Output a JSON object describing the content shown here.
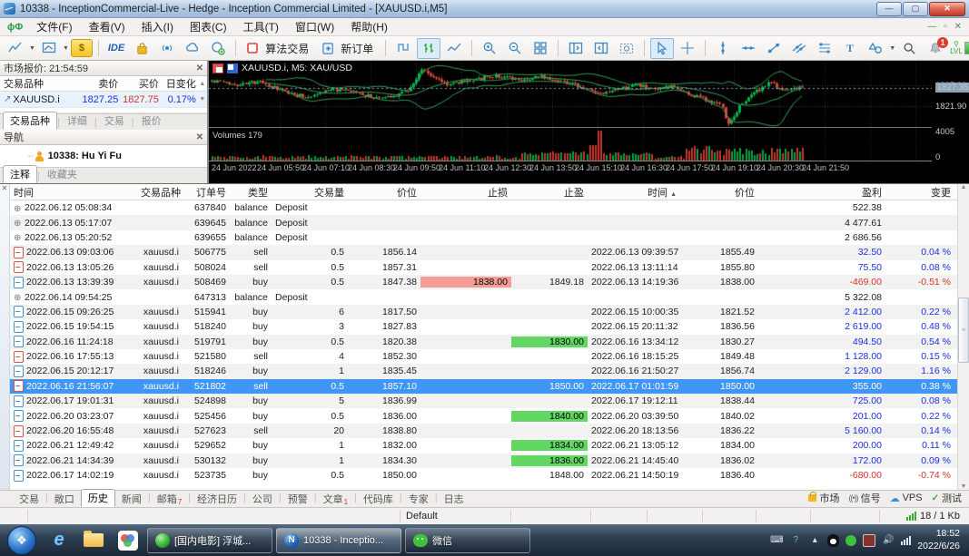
{
  "window": {
    "title": "10338 - InceptionCommercial-Live - Hedge - Inception Commercial Limited - [XAUUSD.i,M5]",
    "controls": {
      "minimize": "—",
      "maximize": "▢",
      "close": "✕"
    }
  },
  "menu": {
    "items": [
      "文件(F)",
      "查看(V)",
      "插入(I)",
      "图表(C)",
      "工具(T)",
      "窗口(W)",
      "帮助(H)"
    ]
  },
  "toolbar": {
    "ide_label": "IDE",
    "algo_label": "算法交易",
    "new_order_label": "新订单",
    "notification_count": "1",
    "lvl_label": "LVL"
  },
  "market_watch": {
    "title": "市场报价: 21:54:59",
    "columns": [
      "交易品种",
      "卖价",
      "买价",
      "日变化"
    ],
    "rows": [
      {
        "symbol": "XAUUSD.i",
        "bid": "1827.25",
        "ask": "1827.75",
        "change": "0.17%"
      }
    ],
    "tabs": [
      "交易品种",
      "详细",
      "交易",
      "报价"
    ],
    "active_tab": "交易品种"
  },
  "navigator": {
    "title": "导航",
    "account": "10338:   Hu Yi Fu",
    "tabs": [
      "注释",
      "收藏夹"
    ],
    "active_tab": "注释"
  },
  "chart_data": {
    "type": "candlestick",
    "title": "XAUUSD.i, M5:  XAU/USD",
    "symbol": "XAUUSD.i",
    "timeframe": "M5",
    "indicator": "Bollinger Bands",
    "current_price": "1827.35",
    "grid_prices": [
      1827.9,
      1821.9
    ],
    "grid_price_labels": [
      "1827.90",
      "1821.90"
    ],
    "price_range": [
      1815.8,
      1835.2
    ],
    "volume_label": "Volumes 179",
    "volume_axis_labels": [
      "4005",
      "0"
    ],
    "volume_max": 4005,
    "time_labels": [
      "24 Jun 2022",
      "24 Jun 05:50",
      "24 Jun 07:10",
      "24 Jun 08:30",
      "24 Jun 09:50",
      "24 Jun 11:10",
      "24 Jun 12:30",
      "24 Jun 13:50",
      "24 Jun 15:10",
      "24 Jun 16:30",
      "24 Jun 17:50",
      "24 Jun 19:10",
      "24 Jun 20:30",
      "24 Jun 21:50"
    ],
    "price_path": [
      [
        0,
        1829.3
      ],
      [
        0.04,
        1828.2
      ],
      [
        0.08,
        1829.0
      ],
      [
        0.12,
        1826.3
      ],
      [
        0.16,
        1824.6
      ],
      [
        0.2,
        1826.8
      ],
      [
        0.24,
        1826.0
      ],
      [
        0.28,
        1824.2
      ],
      [
        0.31,
        1825.0
      ],
      [
        0.335,
        1827.0
      ],
      [
        0.355,
        1832.6
      ],
      [
        0.375,
        1830.5
      ],
      [
        0.4,
        1828.3
      ],
      [
        0.44,
        1829.6
      ],
      [
        0.48,
        1830.8
      ],
      [
        0.52,
        1829.5
      ],
      [
        0.56,
        1830.6
      ],
      [
        0.6,
        1829.0
      ],
      [
        0.63,
        1827.2
      ],
      [
        0.66,
        1825.2
      ],
      [
        0.69,
        1826.8
      ],
      [
        0.72,
        1828.3
      ],
      [
        0.75,
        1826.5
      ],
      [
        0.78,
        1827.6
      ],
      [
        0.81,
        1825.4
      ],
      [
        0.84,
        1823.6
      ],
      [
        0.862,
        1822.5
      ],
      [
        0.875,
        1816.8
      ],
      [
        0.895,
        1822.0
      ],
      [
        0.92,
        1826.0
      ],
      [
        0.945,
        1828.8
      ],
      [
        0.97,
        1826.3
      ],
      [
        1,
        1827.35
      ]
    ]
  },
  "history": {
    "columns": [
      "时间",
      "交易品种",
      "订单号",
      "类型",
      "交易量",
      "价位",
      "止损",
      "止盈",
      "时间",
      "价位",
      "盈利",
      "变更"
    ],
    "sorted_column_index": 8,
    "rows": [
      {
        "kind": "balance",
        "time": "2022.06.12 05:08:34",
        "symbol": "",
        "order": "637840",
        "type": "balance",
        "volume": "Deposit",
        "price": "",
        "sl": "",
        "tp": "",
        "time2": "",
        "price2": "",
        "profit": "522.38",
        "change": ""
      },
      {
        "kind": "balance",
        "time": "2022.06.13 05:17:07",
        "symbol": "",
        "order": "639645",
        "type": "balance",
        "volume": "Deposit",
        "price": "",
        "sl": "",
        "tp": "",
        "time2": "",
        "price2": "",
        "profit": "4 477.61",
        "change": ""
      },
      {
        "kind": "balance",
        "time": "2022.06.13 05:20:52",
        "symbol": "",
        "order": "639655",
        "type": "balance",
        "volume": "Deposit",
        "price": "",
        "sl": "",
        "tp": "",
        "time2": "",
        "price2": "",
        "profit": "2 686.56",
        "change": ""
      },
      {
        "kind": "sell",
        "time": "2022.06.13 09:03:06",
        "symbol": "xauusd.i",
        "order": "506775",
        "type": "sell",
        "volume": "0.5",
        "price": "1856.14",
        "sl": "",
        "tp": "",
        "time2": "2022.06.13 09:39:57",
        "price2": "1855.49",
        "profit": "32.50",
        "change": "0.04 %"
      },
      {
        "kind": "sell",
        "time": "2022.06.13 13:05:26",
        "symbol": "xauusd.i",
        "order": "508024",
        "type": "sell",
        "volume": "0.5",
        "price": "1857.31",
        "sl": "",
        "tp": "",
        "time2": "2022.06.13 13:11:14",
        "price2": "1855.80",
        "profit": "75.50",
        "change": "0.08 %"
      },
      {
        "kind": "buy",
        "time": "2022.06.13 13:39:39",
        "symbol": "xauusd.i",
        "order": "508469",
        "type": "buy",
        "volume": "0.5",
        "price": "1847.38",
        "sl": "1838.00",
        "sl_hl": true,
        "tp": "1849.18",
        "time2": "2022.06.13 14:19:36",
        "price2": "1838.00",
        "profit": "-469.00",
        "change": "-0.51 %"
      },
      {
        "kind": "balance",
        "time": "2022.06.14 09:54:25",
        "symbol": "",
        "order": "647313",
        "type": "balance",
        "volume": "Deposit",
        "price": "",
        "sl": "",
        "tp": "",
        "time2": "",
        "price2": "",
        "profit": "5 322.08",
        "change": ""
      },
      {
        "kind": "buy",
        "time": "2022.06.15 09:26:25",
        "symbol": "xauusd.i",
        "order": "515941",
        "type": "buy",
        "volume": "6",
        "price": "1817.50",
        "sl": "",
        "tp": "",
        "time2": "2022.06.15 10:00:35",
        "price2": "1821.52",
        "profit": "2 412.00",
        "change": "0.22 %"
      },
      {
        "kind": "buy",
        "time": "2022.06.15 19:54:15",
        "symbol": "xauusd.i",
        "order": "518240",
        "type": "buy",
        "volume": "3",
        "price": "1827.83",
        "sl": "",
        "tp": "",
        "time2": "2022.06.15 20:11:32",
        "price2": "1836.56",
        "profit": "2 619.00",
        "change": "0.48 %"
      },
      {
        "kind": "buy",
        "time": "2022.06.16 11:24:18",
        "symbol": "xauusd.i",
        "order": "519791",
        "type": "buy",
        "volume": "0.5",
        "price": "1820.38",
        "sl": "",
        "tp": "1830.00",
        "tp_hl": true,
        "time2": "2022.06.16 13:34:12",
        "price2": "1830.27",
        "profit": "494.50",
        "change": "0.54 %"
      },
      {
        "kind": "sell",
        "time": "2022.06.16 17:55:13",
        "symbol": "xauusd.i",
        "order": "521580",
        "type": "sell",
        "volume": "4",
        "price": "1852.30",
        "sl": "",
        "tp": "",
        "time2": "2022.06.16 18:15:25",
        "price2": "1849.48",
        "profit": "1 128.00",
        "change": "0.15 %"
      },
      {
        "kind": "buy",
        "time": "2022.06.15 20:12:17",
        "symbol": "xauusd.i",
        "order": "518246",
        "type": "buy",
        "volume": "1",
        "price": "1835.45",
        "sl": "",
        "tp": "",
        "time2": "2022.06.16 21:50:27",
        "price2": "1856.74",
        "profit": "2 129.00",
        "change": "1.16 %"
      },
      {
        "kind": "sell",
        "selected": true,
        "time": "2022.06.16 21:56:07",
        "symbol": "xauusd.i",
        "order": "521802",
        "type": "sell",
        "volume": "0.5",
        "price": "1857.10",
        "sl": "",
        "tp": "1850.00",
        "time2": "2022.06.17 01:01:59",
        "price2": "1850.00",
        "profit": "355.00",
        "change": "0.38 %"
      },
      {
        "kind": "buy",
        "time": "2022.06.17 19:01:31",
        "symbol": "xauusd.i",
        "order": "524898",
        "type": "buy",
        "volume": "5",
        "price": "1836.99",
        "sl": "",
        "tp": "",
        "time2": "2022.06.17 19:12:11",
        "price2": "1838.44",
        "profit": "725.00",
        "change": "0.08 %"
      },
      {
        "kind": "buy",
        "time": "2022.06.20 03:23:07",
        "symbol": "xauusd.i",
        "order": "525456",
        "type": "buy",
        "volume": "0.5",
        "price": "1836.00",
        "sl": "",
        "tp": "1840.00",
        "tp_hl": true,
        "time2": "2022.06.20 03:39:50",
        "price2": "1840.02",
        "profit": "201.00",
        "change": "0.22 %"
      },
      {
        "kind": "sell",
        "time": "2022.06.20 16:55:48",
        "symbol": "xauusd.i",
        "order": "527623",
        "type": "sell",
        "volume": "20",
        "price": "1838.80",
        "sl": "",
        "tp": "",
        "time2": "2022.06.20 18:13:56",
        "price2": "1836.22",
        "profit": "5 160.00",
        "change": "0.14 %"
      },
      {
        "kind": "buy",
        "time": "2022.06.21 12:49:42",
        "symbol": "xauusd.i",
        "order": "529652",
        "type": "buy",
        "volume": "1",
        "price": "1832.00",
        "sl": "",
        "tp": "1834.00",
        "tp_hl": true,
        "time2": "2022.06.21 13:05:12",
        "price2": "1834.00",
        "profit": "200.00",
        "change": "0.11 %"
      },
      {
        "kind": "buy",
        "time": "2022.06.21 14:34:39",
        "symbol": "xauusd.i",
        "order": "530132",
        "type": "buy",
        "volume": "1",
        "price": "1834.30",
        "sl": "",
        "tp": "1836.00",
        "tp_hl": true,
        "time2": "2022.06.21 14:45:40",
        "price2": "1836.02",
        "profit": "172.00",
        "change": "0.09 %"
      },
      {
        "kind": "buy",
        "time": "2022.06.17 14:02:19",
        "symbol": "xauusd.i",
        "order": "523735",
        "type": "buy",
        "volume": "0.5",
        "price": "1850.00",
        "sl": "",
        "tp": "1848.00",
        "time2": "2022.06.21 14:50:19",
        "price2": "1836.40",
        "profit": "-680.00",
        "change": "-0.74 %"
      }
    ]
  },
  "bottom_tabs": {
    "tabs": [
      {
        "label": "交易"
      },
      {
        "label": "敞口"
      },
      {
        "label": "历史",
        "active": true
      },
      {
        "label": "新闻"
      },
      {
        "label": "邮箱",
        "badge": "7"
      },
      {
        "label": "经济日历"
      },
      {
        "label": "公司"
      },
      {
        "label": "预警"
      },
      {
        "label": "文章",
        "badge": "1"
      },
      {
        "label": "代码库"
      },
      {
        "label": "专家"
      },
      {
        "label": "日志"
      }
    ],
    "right_items": [
      {
        "label": "市场",
        "icon": "bag"
      },
      {
        "label": "信号",
        "icon": "signal"
      },
      {
        "label": "VPS",
        "icon": "cloud"
      },
      {
        "label": "测试",
        "icon": "check"
      }
    ]
  },
  "status_bar": {
    "profile": "Default",
    "traffic": "18 / 1 Kb"
  },
  "taskbar": {
    "buttons": [
      {
        "label": "[国内电影] 浮城...",
        "icon": "green-circle"
      },
      {
        "label": "10338 - Inceptio...",
        "icon": "mt5",
        "active": true
      },
      {
        "label": "微信",
        "icon": "wechat"
      }
    ],
    "clock_time": "18:52",
    "clock_date": "2022/6/26"
  }
}
